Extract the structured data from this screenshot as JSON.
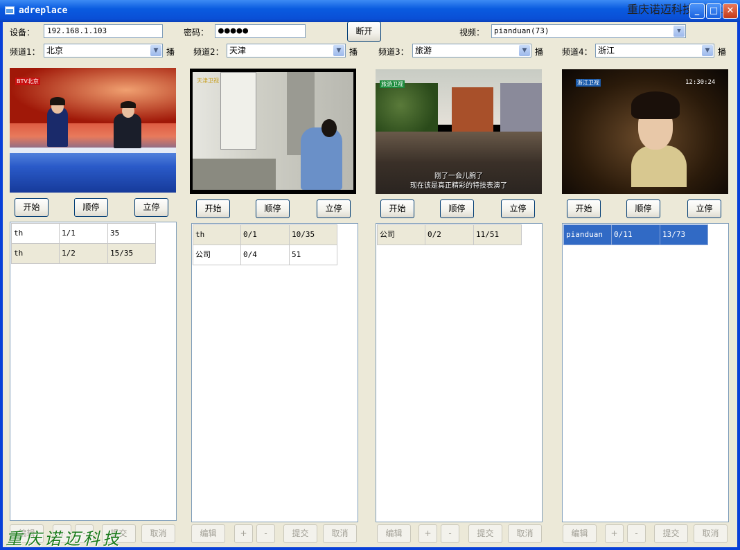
{
  "window": {
    "title": "adreplace",
    "watermark_top": "重庆诺迈科技有限公司",
    "watermark_bottom": "重庆诺迈科技"
  },
  "controls": {
    "minimize": "_",
    "maximize": "□",
    "close": "✕"
  },
  "device": {
    "label": "设备：",
    "value": "192.168.1.103"
  },
  "password": {
    "label": "密码：",
    "value": "●●●●●"
  },
  "disconnect": "断开",
  "video": {
    "label": "视频：",
    "value": "pianduan(73)"
  },
  "channels": [
    {
      "label": "频道1：",
      "value": "北京",
      "play": "播",
      "buttons": {
        "start": "开始",
        "seq_stop": "顺停",
        "stop_now": "立停"
      },
      "rows": [
        [
          "th",
          "1/1",
          "35"
        ],
        [
          "th",
          "1/2",
          "15/35"
        ]
      ],
      "footer": {
        "edit": "编辑",
        "plus": "+",
        "minus": "-",
        "submit": "提交",
        "cancel": "取消"
      }
    },
    {
      "label": "频道2：",
      "value": "天津",
      "play": "播",
      "buttons": {
        "start": "开始",
        "seq_stop": "顺停",
        "stop_now": "立停"
      },
      "rows": [
        [
          "th",
          "0/1",
          "10/35"
        ],
        [
          "公司",
          "0/4",
          "51"
        ]
      ],
      "footer": {
        "edit": "编辑",
        "plus": "+",
        "minus": "-",
        "submit": "提交",
        "cancel": "取消"
      }
    },
    {
      "label": "频道3：",
      "value": "旅游",
      "play": "播",
      "buttons": {
        "start": "开始",
        "seq_stop": "顺停",
        "stop_now": "立停"
      },
      "rows": [
        [
          "公司",
          "0/2",
          "11/51"
        ]
      ],
      "subtitle1": "刚了一会儿腕了",
      "subtitle2": "现在该是真正精彩的特技表演了",
      "footer": {
        "edit": "编辑",
        "plus": "+",
        "minus": "-",
        "submit": "提交",
        "cancel": "取消"
      }
    },
    {
      "label": "频道4：",
      "value": "浙江",
      "play": "播",
      "buttons": {
        "start": "开始",
        "seq_stop": "顺停",
        "stop_now": "立停"
      },
      "rows": [
        [
          "pianduan",
          "0/11",
          "13/73"
        ]
      ],
      "clock": "12:30:24",
      "footer": {
        "edit": "编辑",
        "plus": "+",
        "minus": "-",
        "submit": "提交",
        "cancel": "取消"
      }
    }
  ],
  "video_logos": [
    "BTV北京",
    "天津卫视",
    "旅游卫视",
    "浙江卫视"
  ]
}
